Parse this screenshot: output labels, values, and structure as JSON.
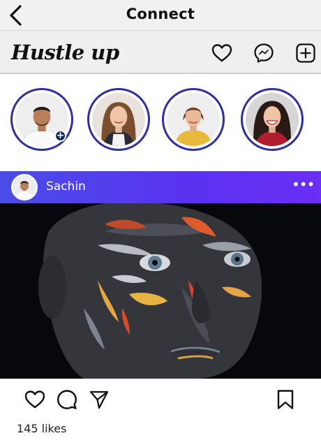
{
  "header": {
    "title": "Connect"
  },
  "app": {
    "logo_text": "Hustle up"
  },
  "stories": [
    {
      "name": "your-story",
      "has_add_badge": true
    },
    {
      "name": "story-2"
    },
    {
      "name": "story-3"
    },
    {
      "name": "story-4"
    }
  ],
  "post": {
    "username": "Sachin",
    "more_label": "•••",
    "likes_text": "145 likes"
  },
  "icons": {
    "back": "chevron-left-icon",
    "heart": "heart-icon",
    "messenger": "messenger-icon",
    "add": "add-square-icon",
    "comment": "comment-icon",
    "share": "send-icon",
    "bookmark": "bookmark-icon"
  },
  "colors": {
    "story_ring": "#2f2f9e",
    "post_header_start": "#4a4de8",
    "post_header_end": "#6a2ef4"
  }
}
